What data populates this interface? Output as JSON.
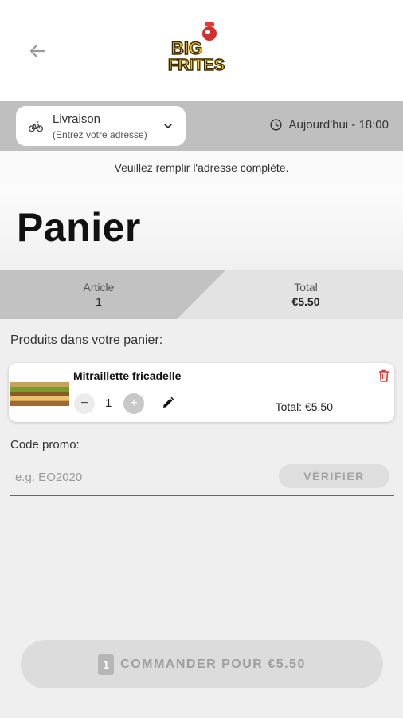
{
  "header": {
    "back_icon": "arrow-left-icon",
    "logo_line1": "BIG",
    "logo_line2": "FRITES"
  },
  "delivery": {
    "mode": "Livraison",
    "address_hint": "(Entrez votre adresse)",
    "time": "Aujourd'hui - 18:00"
  },
  "notice": "Veuillez remplir l'adresse complète.",
  "page": {
    "title": "Panier"
  },
  "summary": {
    "article_label": "Article",
    "article_value": "1",
    "total_label": "Total",
    "total_value": "€5.50"
  },
  "cart": {
    "section_label": "Produits dans votre panier:",
    "items": [
      {
        "name": "Mitraillette fricadelle",
        "quantity": "1",
        "minus": "−",
        "plus": "+",
        "total": "Total: €5.50"
      }
    ]
  },
  "promo": {
    "label": "Code promo:",
    "placeholder": "e.g. EO2020",
    "verify_label": "VÉRIFIER"
  },
  "order": {
    "count": "1",
    "label": "COMMANDER POUR €5.50"
  },
  "colors": {
    "accent_red": "#e53935",
    "logo_yellow": "#f5c518",
    "disabled_gray": "#dcdcdc"
  }
}
